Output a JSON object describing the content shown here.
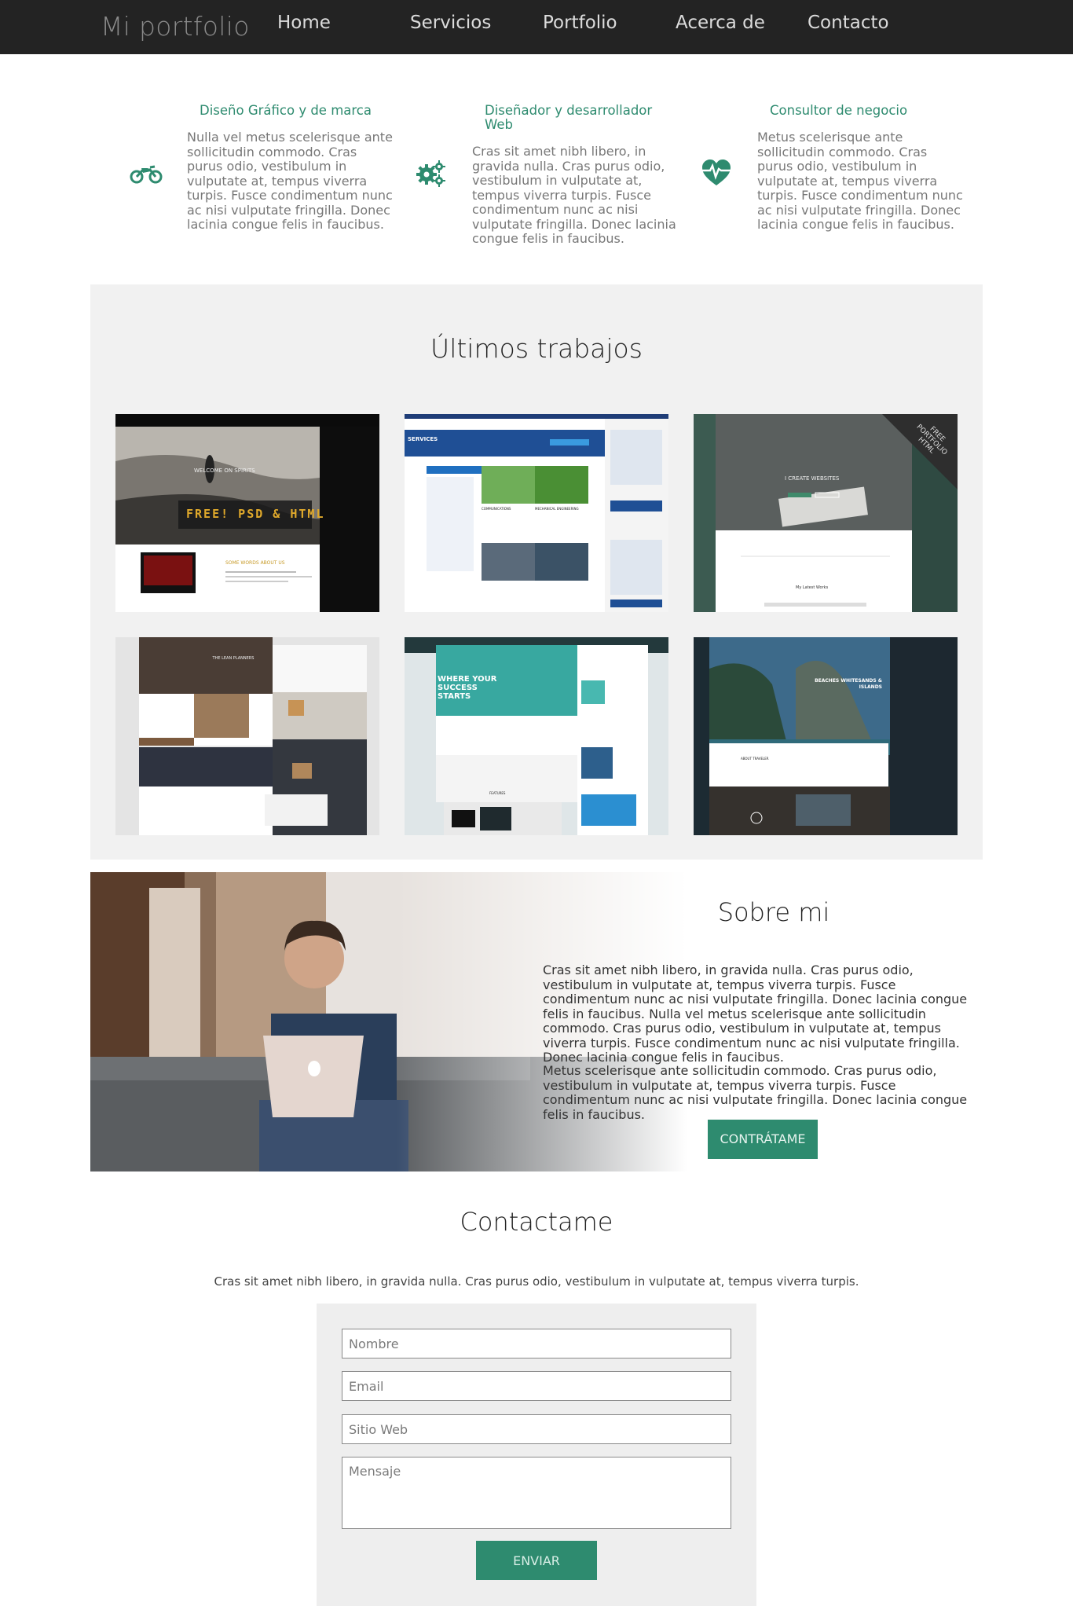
{
  "nav": {
    "brand": "Mi portfolio",
    "items": [
      "Home",
      "Servicios",
      "Portfolio",
      "Acerca de",
      "Contacto"
    ]
  },
  "services": [
    {
      "icon": "motorcycle-icon",
      "title": "Diseño Gráfico y de marca",
      "text": "Nulla vel metus scelerisque ante sollicitudin commodo. Cras purus odio, vestibulum in vulputate at, tempus viverra turpis. Fusce condimentum nunc ac nisi vulputate fringilla. Donec lacinia congue felis in faucibus."
    },
    {
      "icon": "gears-icon",
      "title": "Diseñador y desarrollador Web",
      "text": "Cras sit amet nibh libero, in gravida nulla. Cras purus odio, vestibulum in vulputate at, tempus viverra turpis. Fusce condimentum nunc ac nisi vulputate fringilla. Donec lacinia congue felis in faucibus."
    },
    {
      "icon": "heartbeat-icon",
      "title": "Consultor de negocio",
      "text": "Metus scelerisque ante sollicitudin commodo. Cras purus odio, vestibulum in vulputate at, tempus viverra turpis. Fusce condimentum nunc ac nisi vulputate fringilla. Donec lacinia congue felis in faucibus."
    }
  ],
  "works": {
    "title": "Últimos trabajos",
    "thumbs": [
      {
        "heading": "WELCOME ON SPIRITS",
        "badge": "FREE! PSD & HTML",
        "sub": "SOME WORDS ABOUT US"
      },
      {
        "heading": "SERVICES",
        "sub": "COMMUNICATIONS",
        "sub2": "MECHANICAL ENGINEERING"
      },
      {
        "heading": "I CREATE WEBSITES",
        "badge": "FREE PORTFOLIO HTML",
        "sub": "My Latest Works"
      },
      {
        "heading": "THE LEAN PLANNERS"
      },
      {
        "heading": "WHERE YOUR SUCCESS STARTS",
        "sub": "FEATURES"
      },
      {
        "heading": "BEACHES WHITESANDS & ISLANDS",
        "sub": "ABOUT TRAVELER"
      }
    ]
  },
  "about": {
    "title": "Sobre mi",
    "p1": "Cras sit amet nibh libero, in gravida nulla. Cras purus odio, vestibulum in vulputate at, tempus viverra turpis. Fusce condimentum nunc ac nisi vulputate fringilla. Donec lacinia congue felis in faucibus. Nulla vel metus scelerisque ante sollicitudin commodo. Cras purus odio, vestibulum in vulputate at, tempus viverra turpis. Fusce condimentum nunc ac nisi vulputate fringilla. Donec lacinia congue felis in faucibus.",
    "p2": "Metus scelerisque ante sollicitudin commodo. Cras purus odio, vestibulum in vulputate at, tempus viverra turpis. Fusce condimentum nunc ac nisi vulputate fringilla. Donec lacinia congue felis in faucibus.",
    "button": "CONTRÁTAME"
  },
  "contact": {
    "title": "Contactame",
    "intro": "Cras sit amet nibh libero, in gravida nulla. Cras purus odio, vestibulum in vulputate at, tempus viverra turpis.",
    "fields": {
      "name": "Nombre",
      "email": "Email",
      "website": "Sitio Web",
      "message": "Mensaje"
    },
    "submit": "ENVIAR"
  },
  "colors": {
    "accent": "#2e8b6f",
    "nav_bg": "#232323",
    "works_bg": "#f1f1f1"
  }
}
